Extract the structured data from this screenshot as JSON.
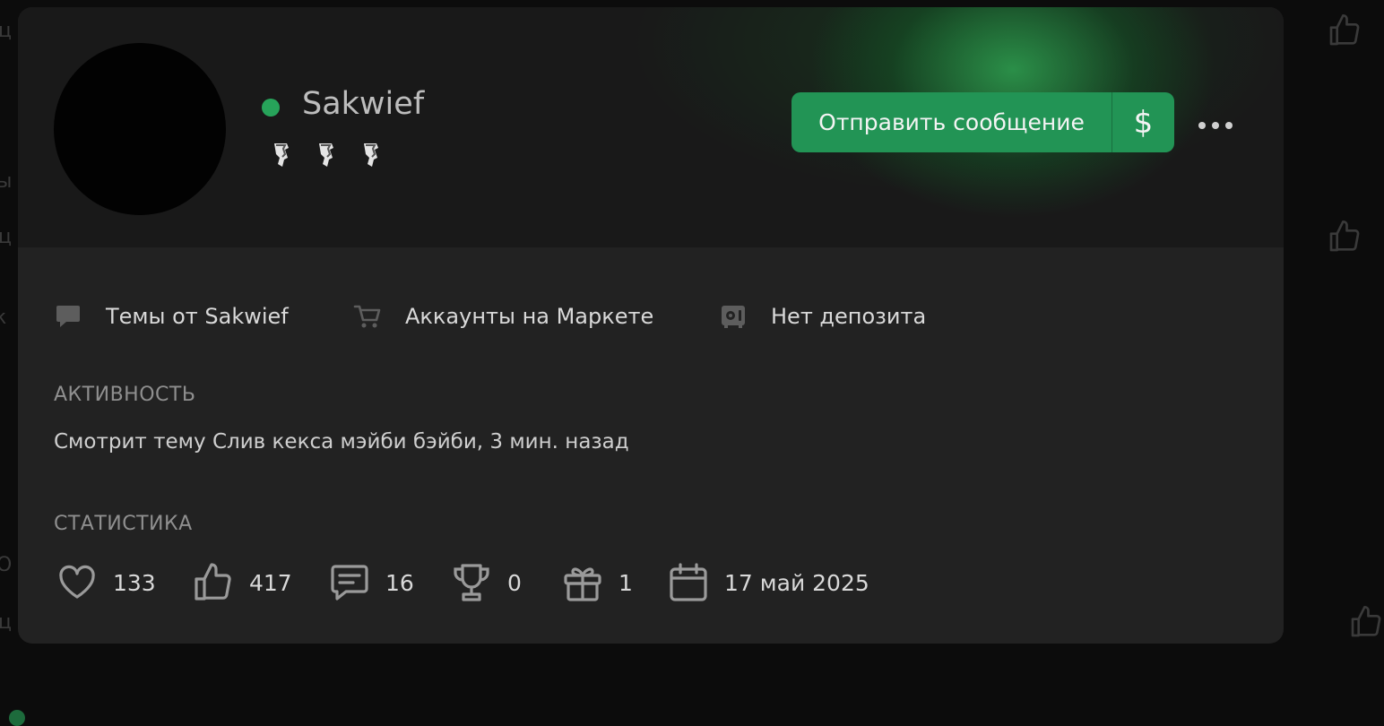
{
  "profile": {
    "username": "Sakwief",
    "online": true,
    "badge_count": 3
  },
  "actions": {
    "send_message": "Отправить сообщение",
    "money": "$",
    "more": "•••"
  },
  "links": [
    {
      "icon": "chat-bubble-icon",
      "label": "Темы от Sakwief"
    },
    {
      "icon": "cart-icon",
      "label": "Аккаунты на Маркете"
    },
    {
      "icon": "safe-icon",
      "label": "Нет депозита"
    }
  ],
  "activity": {
    "title": "АКТИВНОСТЬ",
    "text": "Смотрит тему Слив кекса мэйби бэйби, 3 мин. назад"
  },
  "statistics": {
    "title": "СТАТИСТИКА",
    "items": [
      {
        "icon": "heart-icon",
        "value": "133"
      },
      {
        "icon": "thumbs-up-icon",
        "value": "417"
      },
      {
        "icon": "message-icon",
        "value": "16"
      },
      {
        "icon": "trophy-icon",
        "value": "0"
      },
      {
        "icon": "gift-icon",
        "value": "1"
      },
      {
        "icon": "calendar-icon",
        "value": "17 май 2025"
      }
    ]
  },
  "colors": {
    "accent": "#229455",
    "online": "#27a35a",
    "card": "#222222",
    "page": "#0c0c0c"
  }
}
